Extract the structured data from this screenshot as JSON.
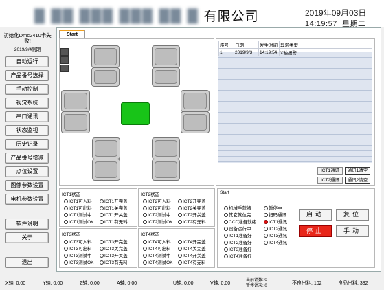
{
  "header": {
    "company": "有限公司",
    "date": "2019年09月03日",
    "time": "14:19:57",
    "weekday": "星期二"
  },
  "left": {
    "init_msg": "初始化Dmc2410卡失败!",
    "init_date": "2019/9/4刹期",
    "buttons": [
      "自动运行",
      "产品番号选择",
      "手动控制",
      "视觉系统",
      "串口通讯",
      "状态监视",
      "历史记录",
      "产品番号增减",
      "点位设置",
      "图像参数设置",
      "电机参数设置",
      "软件说明",
      "关于",
      "退出"
    ]
  },
  "tab": {
    "label": "Start"
  },
  "alarm_table": {
    "headers": [
      "序号",
      "日期",
      "发生时间",
      "异常类型"
    ],
    "rows": [
      [
        "1",
        "2019/9/3",
        "14:19:54",
        "X轴报警"
      ]
    ]
  },
  "comm_buttons": {
    "ict1": "ICT1通讯",
    "ict2": "ICT2通讯",
    "ict3": "ICT3通讯",
    "ict4": "ICT4通讯",
    "ict1_clear": "通讯1清空",
    "ict2_clear": "通讯2清空"
  },
  "ict_groups": [
    {
      "title": "ICT1状态",
      "left": [
        "ICT1可入料",
        "ICT1可出料",
        "ICT1测试中",
        "ICT1测试OK"
      ],
      "right": [
        "ICT1开完盖",
        "ICT1关完盖",
        "ICT1开关盖",
        "ICT1有无料"
      ]
    },
    {
      "title": "ICT2状态",
      "left": [
        "ICT2可入料",
        "ICT2可出料",
        "ICT2测试中",
        "ICT2测试OK"
      ],
      "right": [
        "ICT2开完盖",
        "ICT2关完盖",
        "ICT2开关盖",
        "ICT2有无料"
      ]
    },
    {
      "title": "ICT3状态",
      "left": [
        "ICT3可入料",
        "ICT3可出料",
        "ICT3测试中",
        "ICT3测试OK"
      ],
      "right": [
        "ICT3开完盖",
        "ICT3关完盖",
        "ICT3开关盖",
        "ICT3有无料"
      ]
    },
    {
      "title": "ICT4状态",
      "left": [
        "ICT4可入料",
        "ICT4可出料",
        "ICT4测试中",
        "ICT4测试OK"
      ],
      "right": [
        "ICT4开完盖",
        "ICT4关完盖",
        "ICT4开关盖",
        "ICT4有无料"
      ]
    }
  ],
  "start_panel": {
    "title": "Start",
    "col1": [
      "机械手就绪",
      "其它就位完",
      "CCD准备就绪",
      "设备运行中",
      "ICT1准备好",
      "ICT2准备好",
      "ICT3准备好",
      "ICT4准备好"
    ],
    "col2": [
      "暂停中",
      "扫码通讯",
      "ICT1通讯",
      "ICT2通讯",
      "ICT3通讯",
      "ICT4通讯"
    ],
    "active_col2": 2,
    "buttons": {
      "start": "启动",
      "reset": "复位",
      "stop": "停止",
      "manual": "手动"
    }
  },
  "status_bar": {
    "x": "X轴: 0.00",
    "y": "Y轴: 0.00",
    "z": "Z轴: 0.00",
    "a": "A轴: 0.00",
    "u": "U轴: 0.00",
    "v": "V轴: 0.00",
    "count1": "当前计数: 0",
    "count2": "暂停计次: 0",
    "ng": "不良出料: 102",
    "ok": "良品出料: 382"
  },
  "colors": {
    "green_block": "#18c418",
    "stop_button": "#e8261a",
    "tab_accent": "#f0a020"
  }
}
